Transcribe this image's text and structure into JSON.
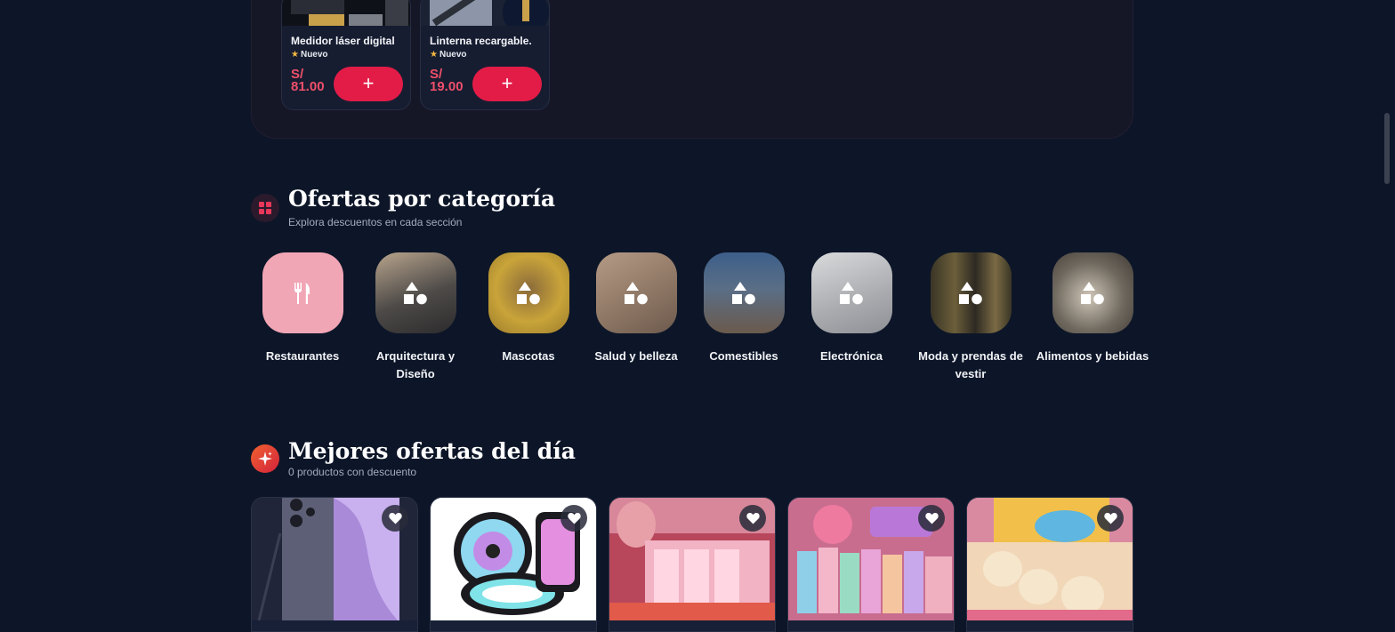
{
  "top_products": [
    {
      "name": "Medidor láser digital",
      "badge": "Nuevo",
      "price_currency": "S/",
      "price_amount": "81.00",
      "add_label": "+"
    },
    {
      "name": "Linterna recargable.",
      "badge": "Nuevo",
      "price_currency": "S/",
      "price_amount": "19.00",
      "add_label": "+"
    }
  ],
  "categories_section": {
    "title": "Ofertas por categoría",
    "subtitle": "Explora descuentos en cada sección",
    "items": [
      {
        "label": "Restaurantes",
        "icon": "utensils-icon"
      },
      {
        "label": "Arquitectura y Diseño",
        "icon": "shapes-icon"
      },
      {
        "label": "Mascotas",
        "icon": "shapes-icon"
      },
      {
        "label": "Salud y belleza",
        "icon": "shapes-icon"
      },
      {
        "label": "Comestibles",
        "icon": "shapes-icon"
      },
      {
        "label": "Electrónica",
        "icon": "shapes-icon"
      },
      {
        "label": "Moda y prendas de vestir",
        "icon": "shapes-icon"
      },
      {
        "label": "Alimentos y bebidas",
        "icon": "shapes-icon"
      }
    ]
  },
  "deals_section": {
    "title": "Mejores ofertas del día",
    "subtitle": "0 productos con descuento",
    "items": [
      {
        "image": "smartphone",
        "favorite_icon": "heart-icon"
      },
      {
        "image": "rgb-fans",
        "favorite_icon": "heart-icon"
      },
      {
        "image": "cosmetics-display",
        "favorite_icon": "heart-icon"
      },
      {
        "image": "cosmetics-boxes",
        "favorite_icon": "heart-icon"
      },
      {
        "image": "soul-display",
        "favorite_icon": "heart-icon"
      }
    ]
  },
  "colors": {
    "background": "#0d1628",
    "accent": "#e31c47",
    "price": "#ef4f6a",
    "restaurant_tile": "#f1a6b6"
  }
}
